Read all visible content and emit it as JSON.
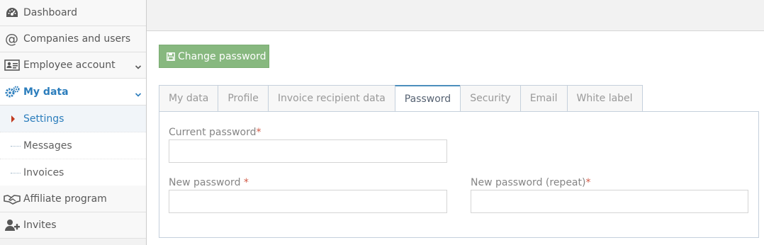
{
  "sidebar": {
    "items": [
      {
        "label": "Dashboard",
        "icon": "tachometer-icon"
      },
      {
        "label": "Companies and users",
        "icon": "at-icon"
      },
      {
        "label": "Employee account",
        "icon": "id-card-icon"
      },
      {
        "label": "My data",
        "icon": "gears-icon"
      },
      {
        "label": "Affiliate program",
        "icon": "handshake-icon"
      },
      {
        "label": "Invites",
        "icon": "user-plus-icon"
      }
    ],
    "sub_items": [
      {
        "label": "Settings"
      },
      {
        "label": "Messages"
      },
      {
        "label": "Invoices"
      }
    ]
  },
  "toolbar": {
    "change_password_label": "Change password",
    "change_password_icon": "floppy-disk-icon"
  },
  "tabs": [
    {
      "label": "My data"
    },
    {
      "label": "Profile"
    },
    {
      "label": "Invoice recipient data"
    },
    {
      "label": "Password"
    },
    {
      "label": "Security"
    },
    {
      "label": "Email"
    },
    {
      "label": "White label"
    }
  ],
  "form": {
    "current_password": {
      "label": "Current password",
      "required_mark": "*",
      "value": ""
    },
    "new_password": {
      "label": "New password ",
      "required_mark": "*",
      "value": ""
    },
    "new_password_repeat": {
      "label": "New password (repeat)",
      "required_mark": "*",
      "value": ""
    }
  },
  "colors": {
    "accent": "#2b7dbc",
    "button_green": "#87b87f",
    "required": "#d15b47",
    "tab_active_border": "#4c8fbd"
  }
}
